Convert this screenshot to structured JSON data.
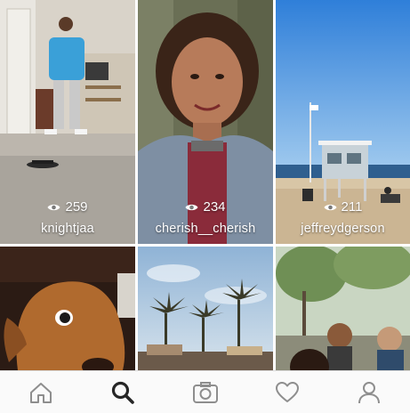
{
  "explore": {
    "tiles": [
      {
        "views": "259",
        "username": "knightjaa"
      },
      {
        "views": "234",
        "username": "cherish__cherish"
      },
      {
        "views": "211",
        "username": "jeffreydgerson"
      }
    ],
    "more_tiles": [
      {
        "subject": "dog"
      },
      {
        "subject": "palm-trees"
      },
      {
        "subject": "people-outdoors"
      }
    ]
  },
  "tabbar": {
    "items": [
      {
        "icon": "home-icon",
        "active": false
      },
      {
        "icon": "search-icon",
        "active": true
      },
      {
        "icon": "camera-icon",
        "active": false
      },
      {
        "icon": "heart-icon",
        "active": false
      },
      {
        "icon": "profile-icon",
        "active": false
      }
    ],
    "active_color": "#262626",
    "inactive_color": "#8e8e8e"
  }
}
